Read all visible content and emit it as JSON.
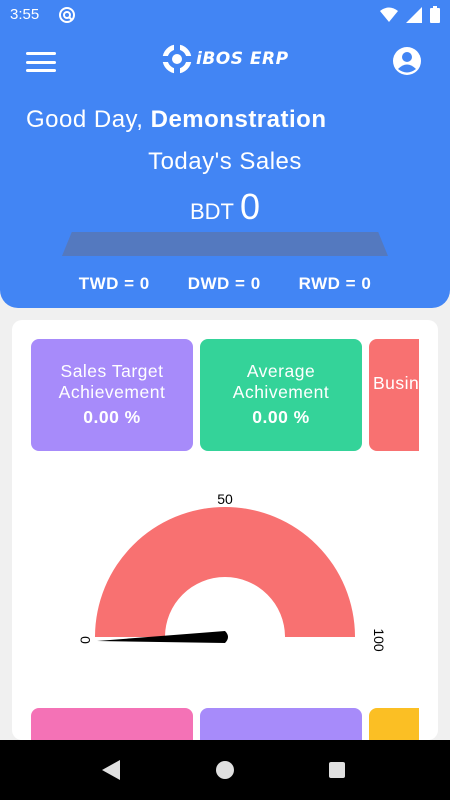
{
  "status_bar": {
    "time": "3:55",
    "app_icon": "at-sign-icon",
    "icons": [
      "wifi-icon",
      "cell-signal-icon",
      "battery-icon"
    ]
  },
  "header": {
    "menu_icon": "hamburger-menu-icon",
    "logo_text": "iBOS ERP",
    "profile_icon": "account-circle-icon",
    "greeting_prefix": "Good Day,",
    "greeting_name": "Demonstration",
    "sales_title": "Today's Sales",
    "sales_currency": "BDT",
    "sales_value": "0",
    "metrics": [
      {
        "label": "TWD = 0"
      },
      {
        "label": "DWD = 0"
      },
      {
        "label": "RWD = 0"
      }
    ]
  },
  "cards": [
    {
      "title": "Sales Target Achievement",
      "line1": "Sales Target",
      "line2": "Achievement",
      "value": "0.00 %",
      "color": "#a78bfa"
    },
    {
      "title": "Average Achivement",
      "line1": "Average",
      "line2": "Achivement",
      "value": "0.00 %",
      "color": "#34d399"
    },
    {
      "title": "Busin",
      "color": "#f87171"
    }
  ],
  "gauge": {
    "min_label": "0",
    "mid_label": "50",
    "max_label": "100",
    "value": 0,
    "min": 0,
    "max": 100,
    "color": "#f87171"
  },
  "bottom_cards": [
    {
      "color": "#f472b6"
    },
    {
      "color": "#a78bfa"
    },
    {
      "color": "#fbbf24"
    }
  ],
  "nav_bar": {
    "back_icon": "back-triangle-icon",
    "home_icon": "home-circle-icon",
    "recents_icon": "recents-square-icon"
  },
  "colors": {
    "primary": "#4285f4"
  }
}
